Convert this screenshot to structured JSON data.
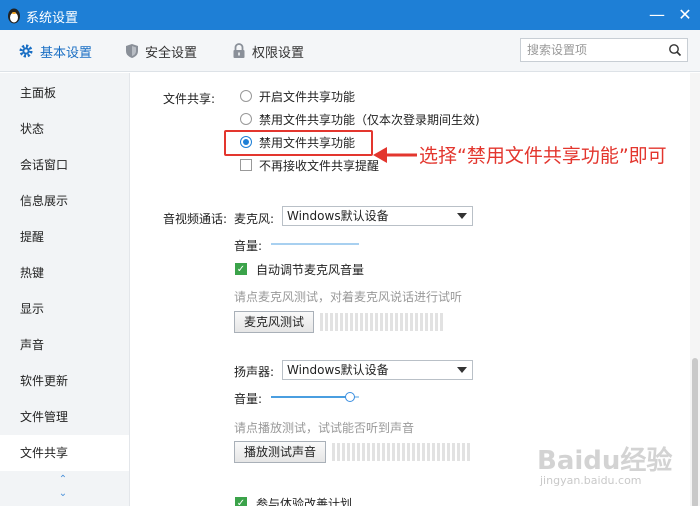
{
  "titlebar": {
    "title": "系统设置",
    "minimize_icon": "minimize-icon",
    "close_icon": "close-icon"
  },
  "tabs": [
    {
      "label": "基本设置",
      "icon": "gear-icon",
      "active": true
    },
    {
      "label": "安全设置",
      "icon": "shield-icon",
      "active": false
    },
    {
      "label": "权限设置",
      "icon": "lock-icon",
      "active": false
    }
  ],
  "search": {
    "placeholder": "搜索设置项"
  },
  "sidebar": {
    "items": [
      {
        "label": "主面板"
      },
      {
        "label": "状态"
      },
      {
        "label": "会话窗口"
      },
      {
        "label": "信息展示"
      },
      {
        "label": "提醒"
      },
      {
        "label": "热键"
      },
      {
        "label": "显示"
      },
      {
        "label": "声音"
      },
      {
        "label": "软件更新"
      },
      {
        "label": "文件管理"
      },
      {
        "label": "文件共享",
        "active": true
      }
    ]
  },
  "file_share": {
    "label": "文件共享:",
    "options": [
      {
        "label": "开启文件共享功能",
        "selected": false
      },
      {
        "label": "禁用文件共享功能（仅本次登录期间生效)",
        "selected": false
      },
      {
        "label": "禁用文件共享功能",
        "selected": true
      }
    ],
    "no_reminder": {
      "label": "不再接收文件共享提醒",
      "checked": false
    }
  },
  "annotation": {
    "text": "选择“禁用文件共享功能”即可",
    "color": "#e3362e"
  },
  "av": {
    "label": "音视频通话:",
    "mic": {
      "label": "麦克风:",
      "device": "Windows默认设备",
      "volume_label": "音量:",
      "auto_adjust": {
        "label": "自动调节麦克风音量",
        "checked": true
      },
      "hint": "请点麦克风测试，对着麦克风说话进行试听",
      "test_button": "麦克风测试"
    },
    "speaker": {
      "label": "扬声器:",
      "device": "Windows默认设备",
      "volume_label": "音量:",
      "volume_level": 0.9,
      "hint": "请点播放测试，试试能否听到声音",
      "test_button": "播放测试声音"
    },
    "experience": {
      "label": "参与体验改善计划",
      "checked": true
    }
  },
  "watermark": {
    "brand": "Baidu经验",
    "url": "jingyan.baidu.com"
  },
  "colors": {
    "accent": "#1e7fd6",
    "annotation": "#e3362e",
    "check": "#3ba34a"
  }
}
